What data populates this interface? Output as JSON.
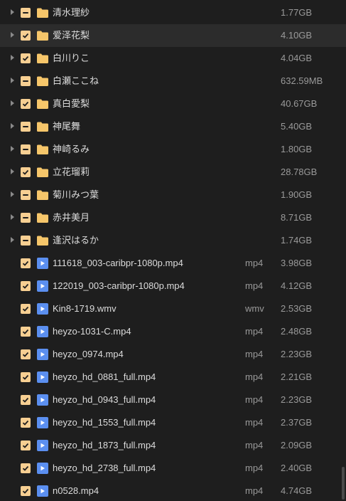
{
  "folders": [
    {
      "name": "清水理紗",
      "size": "1.77GB",
      "check": "partial"
    },
    {
      "name": "爱泽花梨",
      "size": "4.10GB",
      "check": "checked"
    },
    {
      "name": "白川りこ",
      "size": "4.04GB",
      "check": "checked"
    },
    {
      "name": "白瀬ここね",
      "size": "632.59MB",
      "check": "partial"
    },
    {
      "name": "真白愛梨",
      "size": "40.67GB",
      "check": "checked"
    },
    {
      "name": "神尾舞",
      "size": "5.40GB",
      "check": "partial"
    },
    {
      "name": "神崎るみ",
      "size": "1.80GB",
      "check": "partial"
    },
    {
      "name": "立花瑠莉",
      "size": "28.78GB",
      "check": "checked"
    },
    {
      "name": "菊川みつ葉",
      "size": "1.90GB",
      "check": "partial"
    },
    {
      "name": "赤井美月",
      "size": "8.71GB",
      "check": "partial"
    },
    {
      "name": "逢沢はるか",
      "size": "1.74GB",
      "check": "partial"
    }
  ],
  "files": [
    {
      "name": "111618_003-caribpr-1080p.mp4",
      "ext": "mp4",
      "size": "3.98GB"
    },
    {
      "name": "122019_003-caribpr-1080p.mp4",
      "ext": "mp4",
      "size": "4.12GB"
    },
    {
      "name": "Kin8-1719.wmv",
      "ext": "wmv",
      "size": "2.53GB"
    },
    {
      "name": "heyzo-1031-C.mp4",
      "ext": "mp4",
      "size": "2.48GB"
    },
    {
      "name": "heyzo_0974.mp4",
      "ext": "mp4",
      "size": "2.23GB"
    },
    {
      "name": "heyzo_hd_0881_full.mp4",
      "ext": "mp4",
      "size": "2.21GB"
    },
    {
      "name": "heyzo_hd_0943_full.mp4",
      "ext": "mp4",
      "size": "2.23GB"
    },
    {
      "name": "heyzo_hd_1553_full.mp4",
      "ext": "mp4",
      "size": "2.37GB"
    },
    {
      "name": "heyzo_hd_1873_full.mp4",
      "ext": "mp4",
      "size": "2.09GB"
    },
    {
      "name": "heyzo_hd_2738_full.mp4",
      "ext": "mp4",
      "size": "2.40GB"
    },
    {
      "name": "n0528.mp4",
      "ext": "mp4",
      "size": "4.74GB"
    }
  ],
  "colors": {
    "background": "#1e1e1e",
    "checkbox": "#f7cf92",
    "folder": "#f6c66a",
    "video": "#5b8ff0",
    "hover_row": "#2c2c2c"
  },
  "icons": {
    "expander": "chevron-right-icon",
    "folder": "folder-icon",
    "video": "video-file-icon",
    "checkbox_checked": "check-icon",
    "checkbox_partial": "partial-check-icon"
  }
}
